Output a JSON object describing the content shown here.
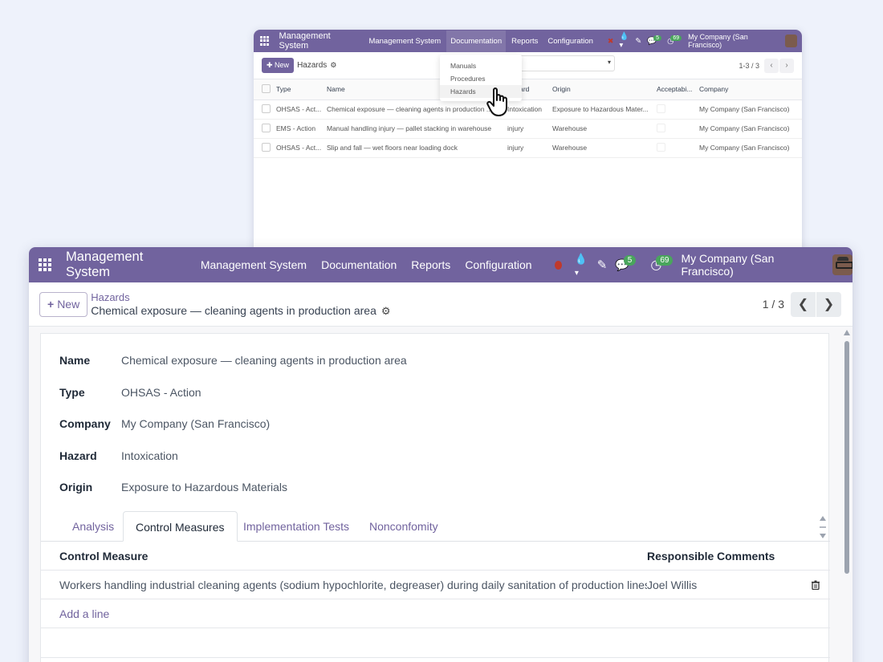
{
  "back_window": {
    "nav": {
      "brand": "Management System",
      "menus": [
        "Management System",
        "Documentation",
        "Reports",
        "Configuration"
      ],
      "chat_count": "5",
      "activity_count": "69",
      "company": "My Company (San Francisco)"
    },
    "control_panel": {
      "new_label": "New",
      "title": "Hazards",
      "pager": "1-3 / 3"
    },
    "dropdown": [
      "Manuals",
      "Procedures",
      "Hazards"
    ],
    "columns": [
      "Type",
      "Name",
      "Hazard",
      "Origin",
      "Acceptabi...",
      "Company"
    ],
    "rows": [
      {
        "type": "OHSAS - Act...",
        "name": "Chemical exposure — cleaning agents in production ...",
        "hazard": "Intoxication",
        "origin": "Exposure to Hazardous Mater...",
        "company": "My Company (San Francisco)"
      },
      {
        "type": "EMS - Action",
        "name": "Manual handling injury — pallet stacking in warehouse",
        "hazard": "injury",
        "origin": "Warehouse",
        "company": "My Company (San Francisco)"
      },
      {
        "type": "OHSAS - Act...",
        "name": "Slip and fall — wet floors near loading dock",
        "hazard": "injury",
        "origin": "Warehouse",
        "company": "My Company (San Francisco)"
      }
    ]
  },
  "front_window": {
    "nav": {
      "brand": "Management System",
      "menus": [
        "Management System",
        "Documentation",
        "Reports",
        "Configuration"
      ],
      "chat_count": "5",
      "activity_count": "69",
      "company": "My Company (San Francisco)"
    },
    "control_panel": {
      "new_label": "New",
      "breadcrumb_parent": "Hazards",
      "record_title": "Chemical exposure — cleaning agents in production area",
      "pager": "1 / 3"
    },
    "fields": [
      {
        "label": "Name",
        "value": "Chemical exposure — cleaning agents in production area"
      },
      {
        "label": "Type",
        "value": "OHSAS - Action"
      },
      {
        "label": "Company",
        "value": "My Company (San Francisco)"
      },
      {
        "label": "Hazard",
        "value": "Intoxication"
      },
      {
        "label": "Origin",
        "value": "Exposure to Hazardous Materials"
      }
    ],
    "tabs": [
      "Analysis",
      "Control Measures",
      "Implementation Tests",
      "Nonconfomity"
    ],
    "active_tab": "Control Measures",
    "lines": {
      "headers": [
        "Control Measure",
        "Responsible",
        "Comments"
      ],
      "rows": [
        {
          "measure": "Workers handling industrial cleaning agents (sodium hypochlorite, degreaser) during daily sanitation of production lines wit...",
          "responsible": "Joel Willis",
          "comments": ""
        }
      ],
      "add_line": "Add a line"
    }
  },
  "colors": {
    "brand": "#71639e",
    "badge": "#49a55c",
    "background": "#eef2fb"
  }
}
